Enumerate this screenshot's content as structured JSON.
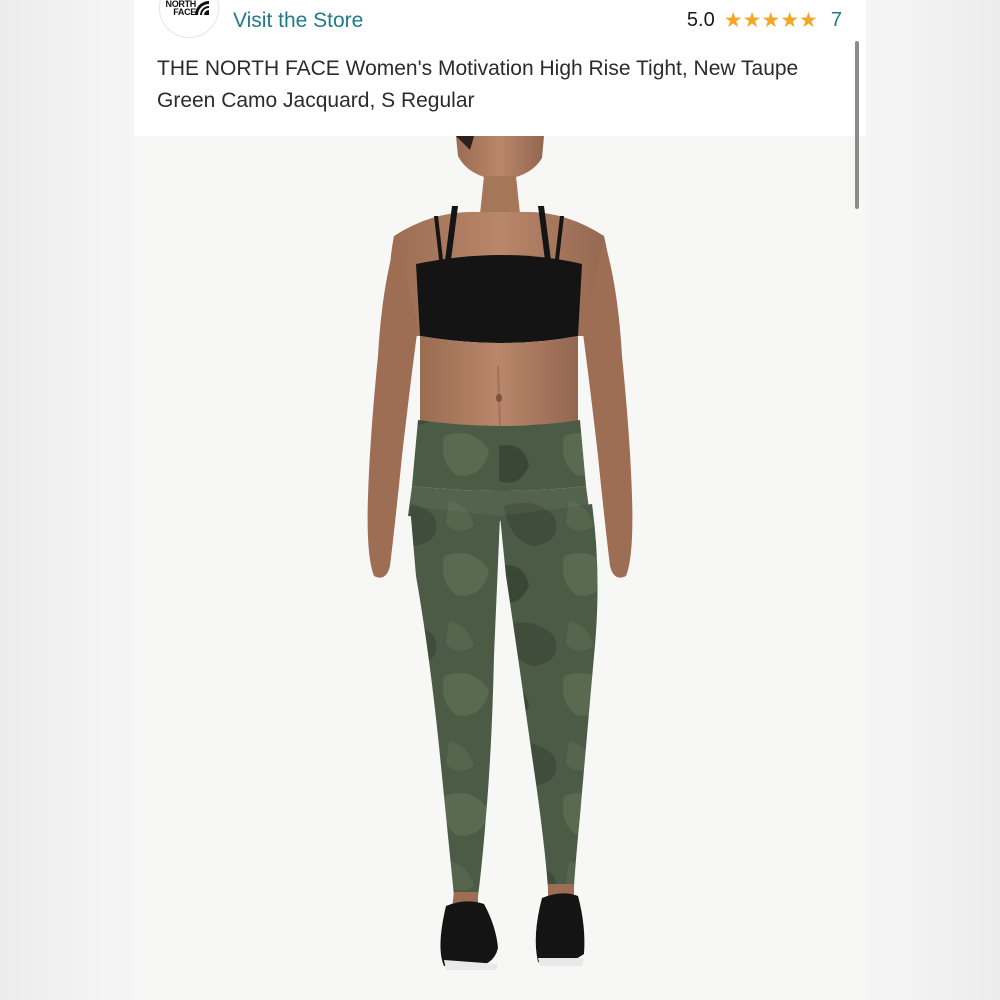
{
  "brand": {
    "logo_text_line1": "NORTH",
    "logo_text_line2": "FACE",
    "logo_icon": "the-north-face-logo"
  },
  "header": {
    "visit_store_label": "Visit the Store",
    "rating_value": "5.0",
    "stars_filled": 5,
    "stars_total": 5,
    "review_count": "7"
  },
  "product": {
    "title": "THE NORTH FACE Women's Motivation High Rise Tight, New Taupe Green Camo Jacquard, S Regular",
    "image_icon": "product-photo"
  },
  "colors": {
    "link": "#1f7a8c",
    "star": "#f5a623",
    "legging": "#4a5a44"
  }
}
